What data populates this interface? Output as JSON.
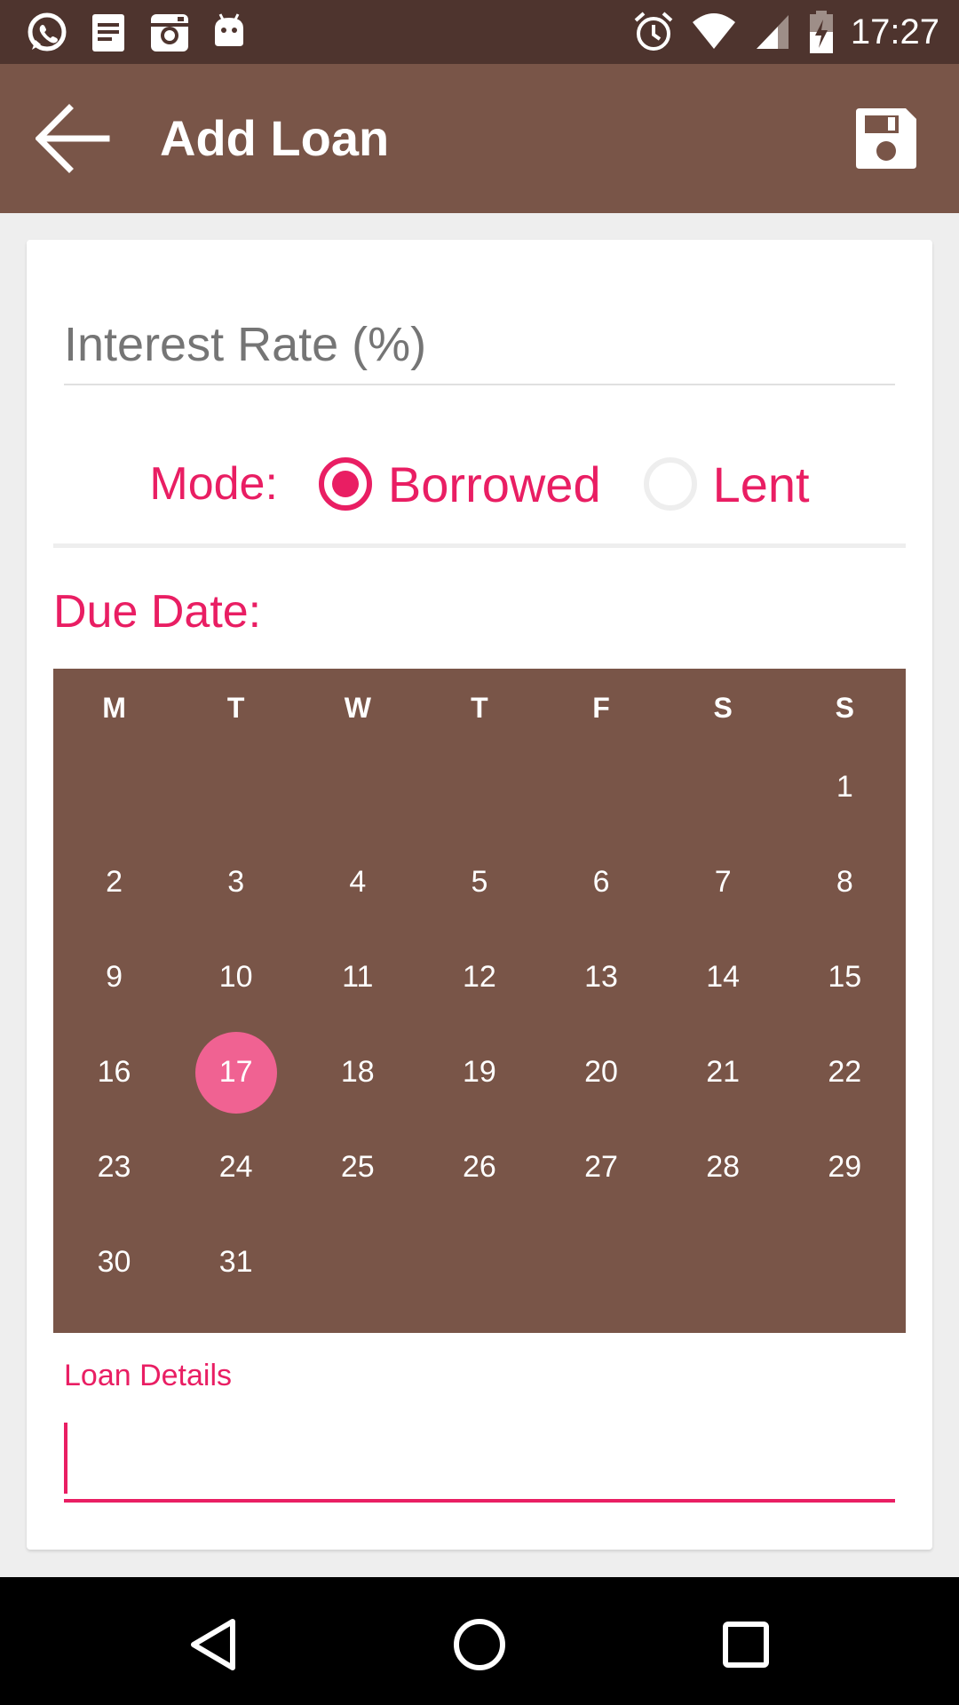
{
  "status_bar": {
    "time": "17:27",
    "left_icons": [
      "whatsapp-icon",
      "notes-icon",
      "instagram-icon",
      "android-icon"
    ],
    "right_icons": [
      "alarm-icon",
      "wifi-icon",
      "signal-icon",
      "battery-charging-icon"
    ]
  },
  "app_bar": {
    "title": "Add Loan",
    "back_icon": "arrow-back-icon",
    "save_icon": "save-icon"
  },
  "form": {
    "interest_rate": {
      "placeholder": "Interest Rate (%)",
      "value": ""
    },
    "mode": {
      "label": "Mode:",
      "options": [
        {
          "label": "Borrowed",
          "selected": true
        },
        {
          "label": "Lent",
          "selected": false
        }
      ]
    },
    "due_date": {
      "label": "Due Date:",
      "weekdays": [
        "M",
        "T",
        "W",
        "T",
        "F",
        "S",
        "S"
      ],
      "weeks": [
        [
          "",
          "",
          "",
          "",
          "",
          "",
          "1"
        ],
        [
          "2",
          "3",
          "4",
          "5",
          "6",
          "7",
          "8"
        ],
        [
          "9",
          "10",
          "11",
          "12",
          "13",
          "14",
          "15"
        ],
        [
          "16",
          "17",
          "18",
          "19",
          "20",
          "21",
          "22"
        ],
        [
          "23",
          "24",
          "25",
          "26",
          "27",
          "28",
          "29"
        ],
        [
          "30",
          "31",
          "",
          "",
          "",
          "",
          ""
        ]
      ],
      "selected_day": "17"
    },
    "loan_details": {
      "label": "Loan Details",
      "value": ""
    }
  },
  "colors": {
    "status_bar": "#4e342e",
    "primary": "#795548",
    "accent": "#e91e63",
    "selected_day": "#f06292"
  },
  "nav_bar": {
    "icons": [
      "nav-back-icon",
      "nav-home-icon",
      "nav-recents-icon"
    ]
  }
}
